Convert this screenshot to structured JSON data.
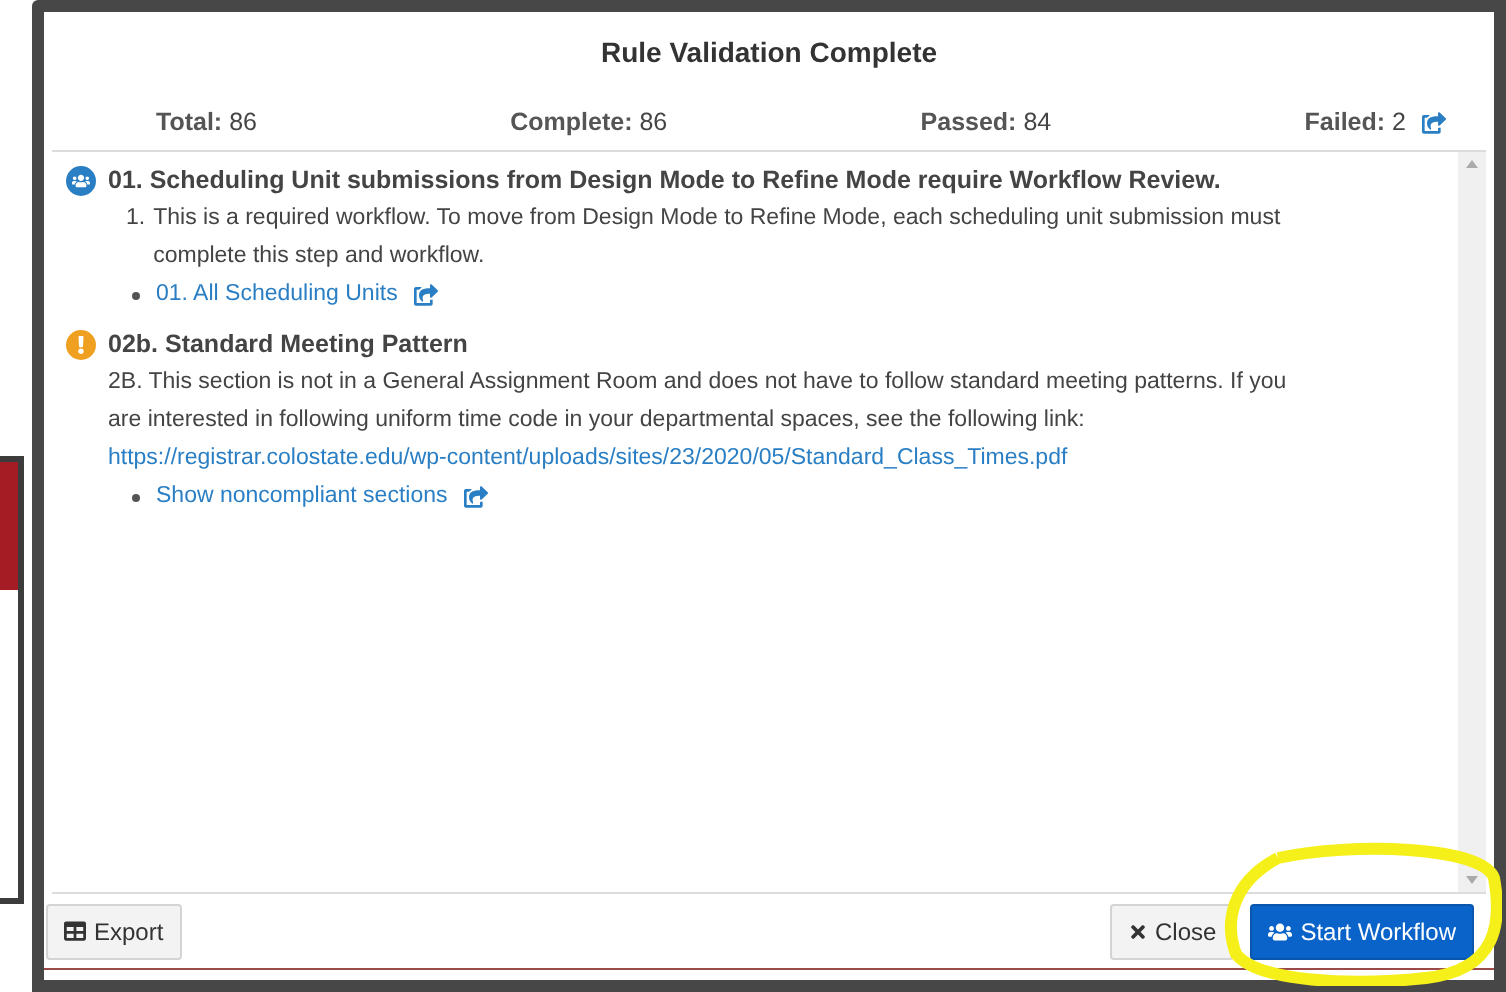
{
  "dialog": {
    "title": "Rule Validation Complete"
  },
  "summary": [
    {
      "label": "Total:",
      "value": "86",
      "link_icon": false
    },
    {
      "label": "Complete:",
      "value": "86",
      "link_icon": false
    },
    {
      "label": "Passed:",
      "value": "84",
      "link_icon": false
    },
    {
      "label": "Failed:",
      "value": "2",
      "link_icon": true
    }
  ],
  "rules": [
    {
      "kind": "workflow",
      "title": "01. Scheduling Unit submissions from Design Mode to Refine Mode require Workflow Review.",
      "number": "1.",
      "text": "This is a required workflow. To move from Design Mode to Refine Mode, each scheduling unit submission must complete this step and workflow.",
      "links": [
        "01. All Scheduling Units"
      ]
    },
    {
      "kind": "warning",
      "title": "02b. Standard Meeting Pattern",
      "text": "2B. This section is not in a General Assignment Room and does not have to follow standard meeting patterns. If you are interested in following uniform time code in your departmental spaces, see the following link:",
      "url": "https://registrar.colostate.edu/wp-content/uploads/sites/23/2020/05/Standard_Class_Times.pdf",
      "links": [
        "Show noncompliant sections"
      ]
    }
  ],
  "footer": {
    "buttons": [
      {
        "kind": "export",
        "label": "Export"
      },
      {
        "kind": "close",
        "label": "Close"
      },
      {
        "kind": "primary",
        "label": "Start Workflow"
      }
    ]
  }
}
